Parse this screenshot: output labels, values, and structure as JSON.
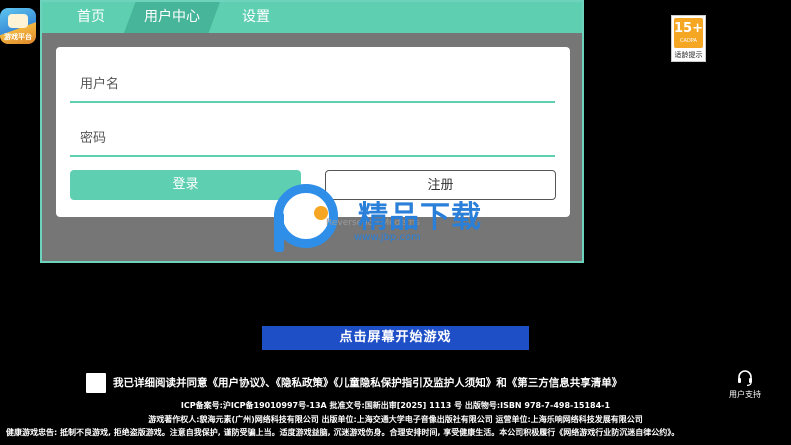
{
  "app_icon": {
    "text": "游戏平台",
    "bg": "#3a8ed8"
  },
  "age_badge": {
    "rating": "15+",
    "sub": "CADPA",
    "label": "适龄提示",
    "color": "#f5a623"
  },
  "tabs": [
    {
      "label": "首页"
    },
    {
      "label": "用户中心",
      "active": true
    },
    {
      "label": "设置"
    }
  ],
  "login_form": {
    "username_placeholder": "用户名",
    "password_placeholder": "密码",
    "login_label": "登录",
    "register_label": "注册",
    "accent": "#5fcfb2"
  },
  "watermark": {
    "title": "精品下载",
    "url": "www.jbp.com",
    "ghost_text": "Reverse ioo Moderns",
    "color": "#2e8ee8"
  },
  "start_banner": {
    "label": "点击屏幕开始游戏",
    "bg": "#1f4fc7"
  },
  "agreement": {
    "text": "我已详细阅读并同意《用户协议》、《隐私政策》《儿童隐私保护指引及监护人须知》和《第三方信息共享清单》"
  },
  "support": {
    "label": "用户支持",
    "icon": "headset-icon"
  },
  "footer": {
    "line1": "ICP备案号:沪ICP备19010997号-13A 批准文号:国新出审[2025] 1113 号 出版物号:ISBN 978-7-498-15184-1",
    "line2": "游戏著作权人:貌海元素(广州)网络科技有限公司 出版单位:上海交通大学电子音像出版社有限公司 运营单位:上海乐响网络科技发展有限公司",
    "line3": "健康游戏忠告: 抵制不良游戏, 拒绝盗版游戏。注意自我保护, 谨防受骗上当。适度游戏益脑, 沉迷游戏伤身。合理安排时间, 享受健康生活。本公司积极履行《网络游戏行业防沉迷自律公约》。"
  }
}
